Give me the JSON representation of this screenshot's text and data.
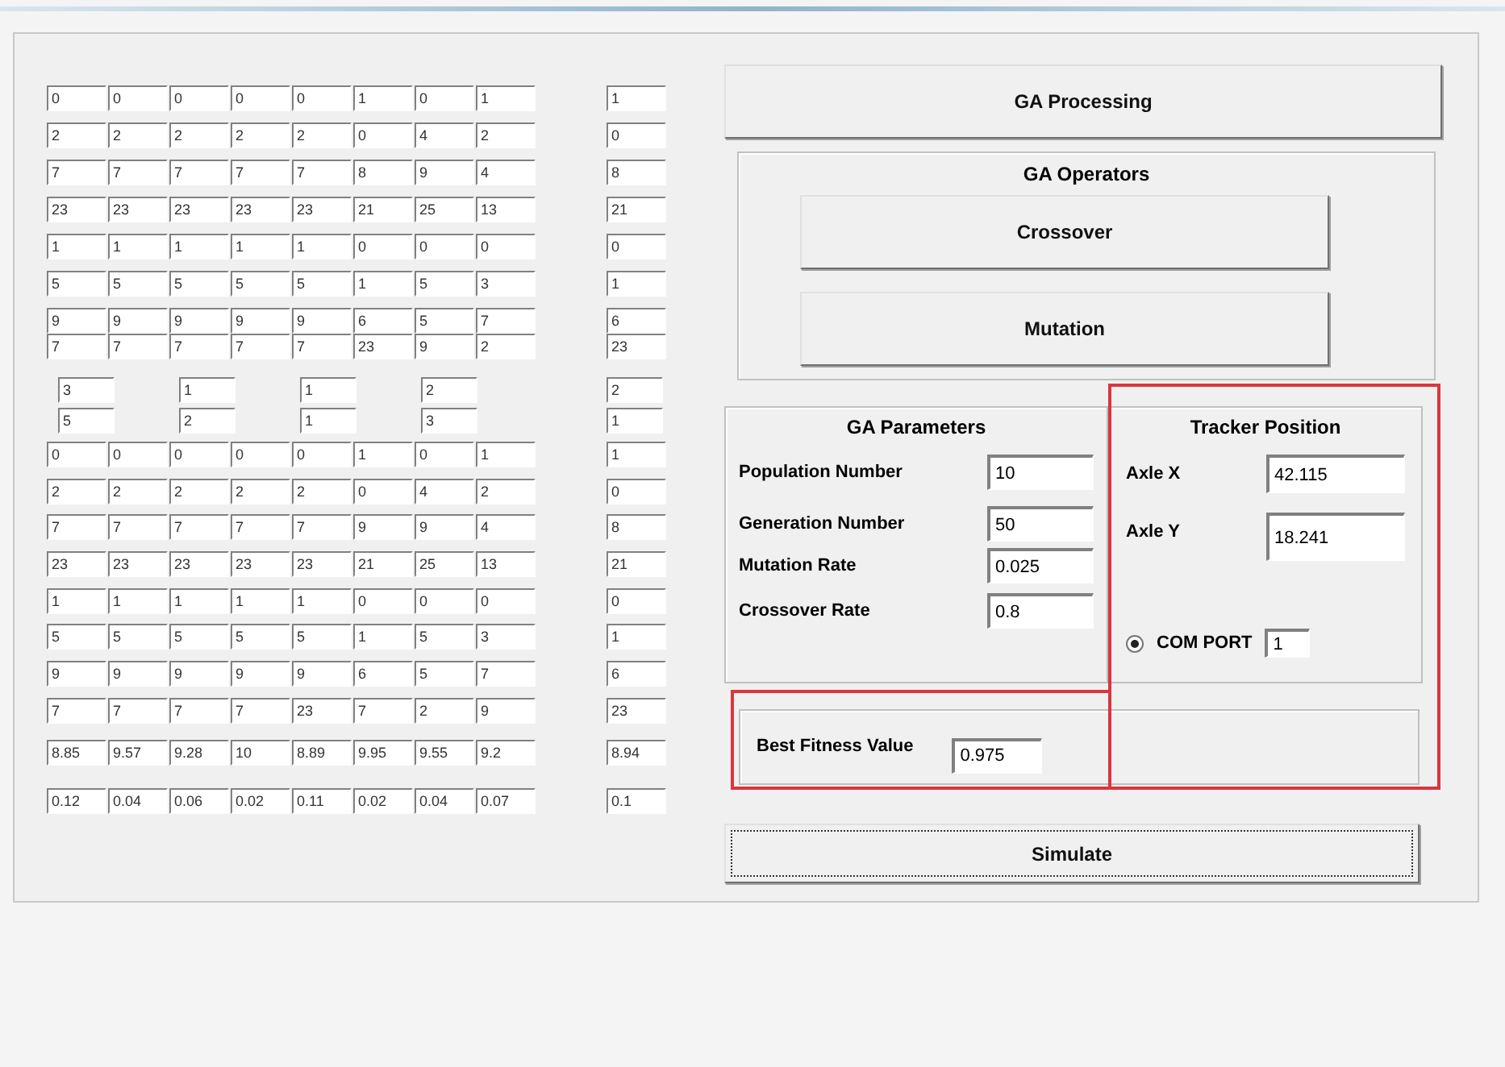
{
  "population_grid": [
    {
      "genes": [
        "0",
        "0",
        "0",
        "0",
        "0",
        "1",
        "0",
        "1"
      ],
      "result": "1"
    },
    {
      "genes": [
        "2",
        "2",
        "2",
        "2",
        "2",
        "0",
        "4",
        "2"
      ],
      "result": "0"
    },
    {
      "genes": [
        "7",
        "7",
        "7",
        "7",
        "7",
        "8",
        "9",
        "4"
      ],
      "result": "8"
    },
    {
      "genes": [
        "23",
        "23",
        "23",
        "23",
        "23",
        "21",
        "25",
        "13"
      ],
      "result": "21"
    },
    {
      "genes": [
        "1",
        "1",
        "1",
        "1",
        "1",
        "0",
        "0",
        "0"
      ],
      "result": "0"
    },
    {
      "genes": [
        "5",
        "5",
        "5",
        "5",
        "5",
        "1",
        "5",
        "3"
      ],
      "result": "1"
    },
    {
      "genes": [
        "9",
        "9",
        "9",
        "9",
        "9",
        "6",
        "5",
        "7"
      ],
      "result": "6"
    },
    {
      "genes": [
        "7",
        "7",
        "7",
        "7",
        "7",
        "23",
        "9",
        "2"
      ],
      "result": "23"
    }
  ],
  "selection_grid": [
    {
      "genes": [
        "3",
        "1",
        "1",
        "2"
      ],
      "result": "2"
    },
    {
      "genes": [
        "5",
        "2",
        "1",
        "3"
      ],
      "result": "1"
    }
  ],
  "offspring_grid": [
    {
      "genes": [
        "0",
        "0",
        "0",
        "0",
        "0",
        "1",
        "0",
        "1"
      ],
      "result": "1"
    },
    {
      "genes": [
        "2",
        "2",
        "2",
        "2",
        "2",
        "0",
        "4",
        "2"
      ],
      "result": "0"
    },
    {
      "genes": [
        "7",
        "7",
        "7",
        "7",
        "7",
        "9",
        "9",
        "4"
      ],
      "result": "8"
    },
    {
      "genes": [
        "23",
        "23",
        "23",
        "23",
        "23",
        "21",
        "25",
        "13"
      ],
      "result": "21"
    },
    {
      "genes": [
        "1",
        "1",
        "1",
        "1",
        "1",
        "0",
        "0",
        "0"
      ],
      "result": "0"
    },
    {
      "genes": [
        "5",
        "5",
        "5",
        "5",
        "5",
        "1",
        "5",
        "3"
      ],
      "result": "1"
    },
    {
      "genes": [
        "9",
        "9",
        "9",
        "9",
        "9",
        "6",
        "5",
        "7"
      ],
      "result": "6"
    },
    {
      "genes": [
        "7",
        "7",
        "7",
        "7",
        "23",
        "7",
        "2",
        "9"
      ],
      "result": "23"
    }
  ],
  "fitness_grid": [
    {
      "genes": [
        "8.85",
        "9.57",
        "9.28",
        "10",
        "8.89",
        "9.95",
        "9.55",
        "9.2"
      ],
      "result": "8.94"
    },
    {
      "genes": [
        "0.12",
        "0.04",
        "0.06",
        "0.02",
        "0.11",
        "0.02",
        "0.04",
        "0.07"
      ],
      "result": "0.1"
    }
  ],
  "processing_button": "GA Processing",
  "operators": {
    "title": "GA Operators",
    "buttons": [
      "Crossover",
      "Mutation"
    ]
  },
  "parameters": {
    "title": "GA Parameters",
    "fields": [
      {
        "label": "Population Number",
        "value": "10"
      },
      {
        "label": "Generation Number",
        "value": "50"
      },
      {
        "label": "Mutation Rate",
        "value": "0.025"
      },
      {
        "label": "Crossover Rate",
        "value": "0.8"
      }
    ]
  },
  "tracker": {
    "title": "Tracker Position",
    "highlighted": true,
    "fields": [
      {
        "label": "Axle X",
        "value": "42.115"
      },
      {
        "label": "Axle Y",
        "value": "18.241"
      }
    ],
    "com_port": {
      "label": "COM PORT",
      "selected": true,
      "value": "1"
    }
  },
  "best_fitness": {
    "label": "Best Fitness Value",
    "value": "0.975",
    "highlighted": true
  },
  "simulate_button": {
    "label": "Simulate",
    "focused": true
  }
}
